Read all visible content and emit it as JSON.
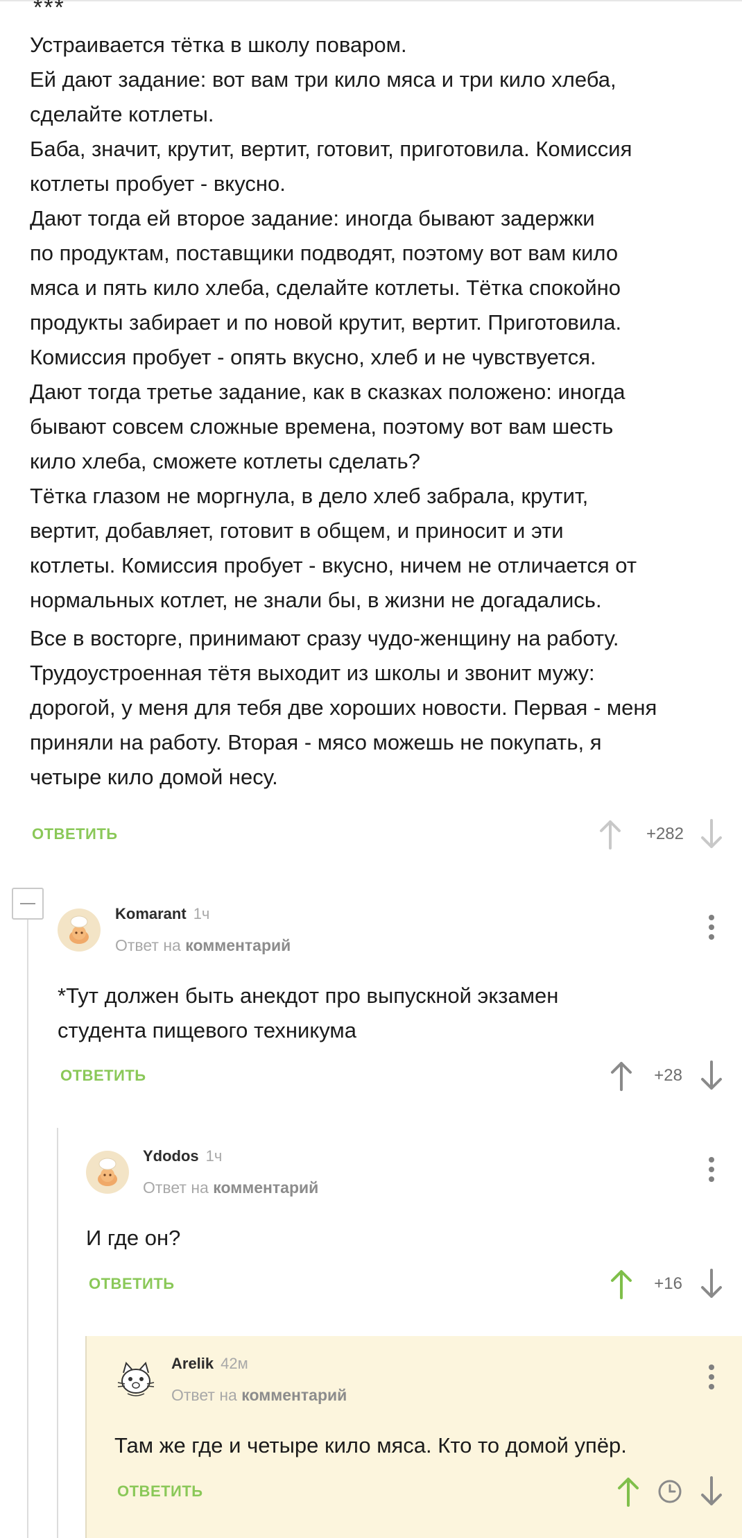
{
  "stars": "***",
  "story": {
    "lines": [
      "Устраивается тётка в школу поваром.",
      "Ей дают задание: вот вам три кило мяса и три кило хлеба,",
      "сделайте котлеты.",
      "Баба, значит, крутит, вертит, готовит, приготовила. Комиссия",
      "котлеты пробует - вкусно.",
      "Дают тогда ей второе задание: иногда бывают задержки",
      "по продуктам, поставщики подводят, поэтому вот вам кило",
      "мяса и пять кило хлеба, сделайте котлеты. Тётка спокойно",
      "продукты забирает и по новой крутит, вертит. Приготовила.",
      "Комиссия пробует - опять вкусно, хлеб и не чувствуется.",
      "Дают тогда третье задание, как в сказках положено: иногда",
      "бывают совсем сложные времена, поэтому вот вам шесть",
      "кило хлеба, сможете котлеты сделать?",
      "Тётка глазом не моргнула, в дело хлеб забрала, крутит,",
      "вертит, добавляет, готовит в общем, и приносит и эти",
      "котлеты. Комиссия пробует - вкусно, ничем не отличается от",
      "нормальных котлет, не знали бы, в жизни не догадались.",
      "Все в восторге, принимают сразу чудо-женщину на работу.",
      "Трудоустроенная тётя выходит из школы и звонит мужу:",
      "дорогой, у меня для тебя две хороших новости. Первая - меня",
      "приняли на работу. Вторая - мясо можешь не покупать, я",
      "четыре кило домой несу."
    ],
    "reply_label": "ОТВЕТИТЬ",
    "score": "+282"
  },
  "comments": [
    {
      "author": "Komarant",
      "time": "1ч",
      "reply_prefix": "Ответ на",
      "reply_target": "комментарий",
      "text_lines": [
        "*Тут должен быть анекдот про выпускной экзамен",
        "студента пищевого техникума"
      ],
      "reply_label": "ОТВЕТИТЬ",
      "score": "+28"
    },
    {
      "author": "Ydodos",
      "time": "1ч",
      "reply_prefix": "Ответ на",
      "reply_target": "комментарий",
      "text_lines": [
        "И где он?"
      ],
      "reply_label": "ОТВЕТИТЬ",
      "score": "+16"
    },
    {
      "author": "Arelik",
      "time": "42м",
      "reply_prefix": "Ответ на",
      "reply_target": "комментарий",
      "text_lines": [
        "Там же где и четыре кило мяса. Кто то домой упёр."
      ],
      "reply_label": "ОТВЕТИТЬ",
      "score": ""
    }
  ],
  "colors": {
    "accent_green": "#8ac858",
    "vote_grey": "#b5b5b5",
    "highlight_bg": "#fcf5dd"
  },
  "icons": [
    "arrow-up-icon",
    "arrow-down-icon",
    "kebab-menu-icon",
    "clock-icon",
    "collapse-icon",
    "chef-avatar-icon",
    "cat-avatar-icon"
  ]
}
